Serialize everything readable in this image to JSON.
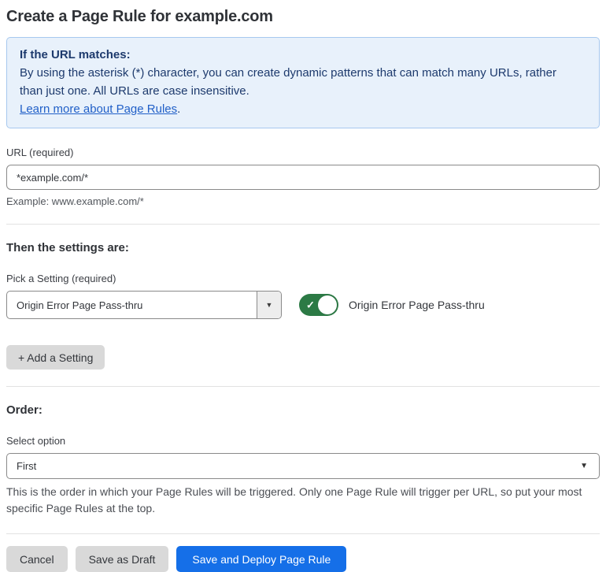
{
  "page": {
    "title": "Create a Page Rule for example.com"
  },
  "info_box": {
    "heading": "If the URL matches:",
    "body": "By using the asterisk (*) character, you can create dynamic patterns that can match many URLs, rather than just one. All URLs are case insensitive.",
    "link_label": "Learn more about Page Rules",
    "link_suffix": "."
  },
  "url_field": {
    "label": "URL (required)",
    "value": "*example.com/*",
    "hint": "Example: www.example.com/*"
  },
  "settings_section": {
    "heading": "Then the settings are:",
    "picker_label": "Pick a Setting (required)",
    "picker_value": "Origin Error Page Pass-thru",
    "toggle_label": "Origin Error Page Pass-thru",
    "toggle_state": "on",
    "add_setting_label": "+ Add a Setting"
  },
  "order_section": {
    "heading": "Order:",
    "select_label": "Select option",
    "select_value": "First",
    "description": "This is the order in which your Page Rules will be triggered. Only one Page Rule will trigger per URL, so put your most specific Page Rules at the top."
  },
  "footer": {
    "cancel_label": "Cancel",
    "save_draft_label": "Save as Draft",
    "save_deploy_label": "Save and Deploy Page Rule"
  },
  "icons": {
    "chevron_down": "▼",
    "check": "✓"
  },
  "colors": {
    "info_bg": "#e8f1fb",
    "info_border": "#a7c8ef",
    "info_text": "#1d3a6d",
    "link": "#2160c8",
    "toggle_on": "#2c7a45",
    "primary_button": "#156fe8",
    "gray_button": "#d9d9d9"
  }
}
